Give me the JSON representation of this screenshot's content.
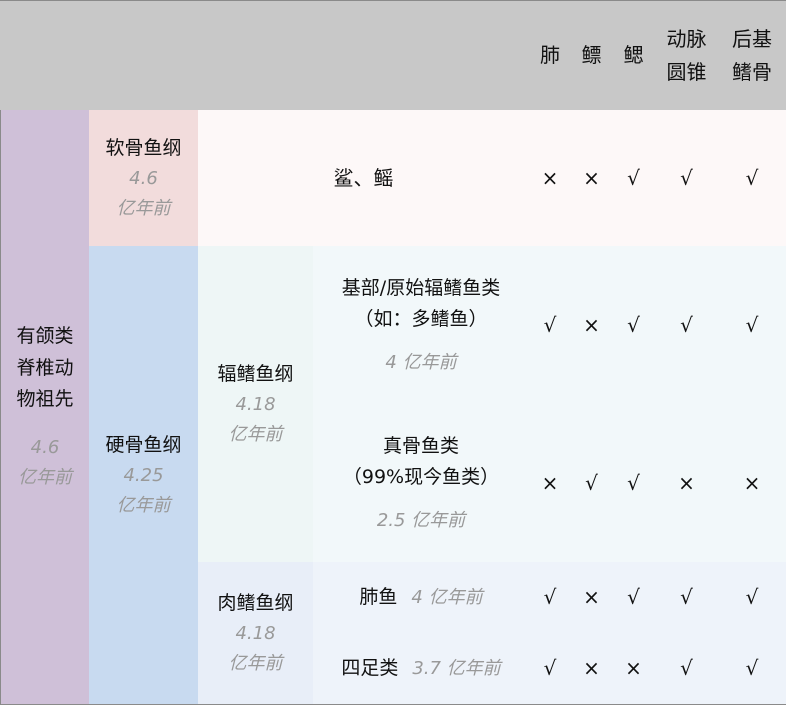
{
  "header": {
    "columns": [
      "肺",
      "鳔",
      "鳃",
      "动脉圆锥",
      "后基鳍骨"
    ],
    "col_lines": [
      [
        "肺"
      ],
      [
        "鳔"
      ],
      [
        "鳃"
      ],
      [
        "动脉",
        "圆锥"
      ],
      [
        "后基",
        "鳍骨"
      ]
    ]
  },
  "ancestor": {
    "lines": [
      "有颌类",
      "脊椎动",
      "物祖先"
    ],
    "time": [
      "4.6",
      "亿年前"
    ]
  },
  "cartilaginous": {
    "name": "软骨鱼纲",
    "time": [
      "4.6",
      "亿年前"
    ],
    "examples": "鲨、鳐",
    "marks": [
      "×",
      "×",
      "√",
      "√",
      "√"
    ]
  },
  "bony": {
    "name": "硬骨鱼纲",
    "time": [
      "4.25",
      "亿年前"
    ]
  },
  "ray_finned": {
    "name": "辐鳍鱼纲",
    "time": [
      "4.18",
      "亿年前"
    ]
  },
  "lobe_finned": {
    "name": "肉鳍鱼纲",
    "time": [
      "4.18",
      "亿年前"
    ]
  },
  "rows": [
    {
      "lines": [
        "基部/原始辐鳍鱼类",
        "（如：多鳍鱼）"
      ],
      "time": "4  亿年前",
      "marks": [
        "√",
        "×",
        "√",
        "√",
        "√"
      ]
    },
    {
      "lines": [
        "真骨鱼类",
        "（99%现今鱼类）"
      ],
      "time": "2.5  亿年前",
      "marks": [
        "×",
        "√",
        "√",
        "×",
        "×"
      ]
    },
    {
      "lines": [
        "肺鱼"
      ],
      "time": "4  亿年前",
      "marks": [
        "√",
        "×",
        "√",
        "√",
        "√"
      ]
    },
    {
      "lines": [
        "四足类"
      ],
      "time": "3.7  亿年前",
      "marks": [
        "√",
        "×",
        "×",
        "√",
        "√"
      ]
    }
  ]
}
